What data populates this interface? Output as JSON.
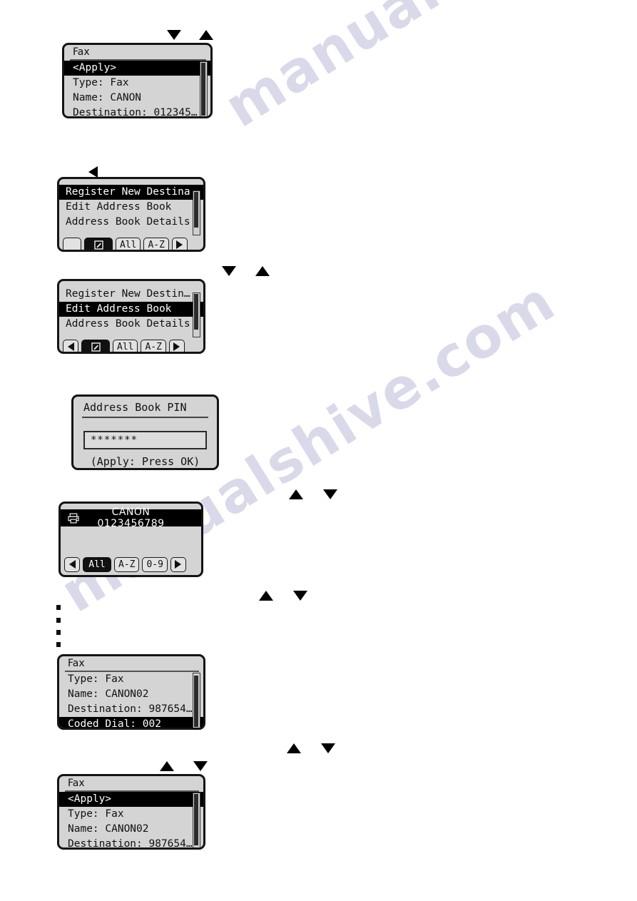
{
  "watermark": {
    "line1": "manualshive.com",
    "line2": "manualshive.com"
  },
  "screens": {
    "fax_apply_canon": {
      "title": "Fax",
      "rows": [
        {
          "text": "<Apply>",
          "selected": true
        },
        {
          "text": "Type: Fax",
          "selected": false
        },
        {
          "text": "Name: CANON",
          "selected": false
        },
        {
          "text": "Destination: 012345…",
          "selected": false
        }
      ]
    },
    "addressbook_menu_1": {
      "rows": [
        {
          "text": "Register New Destina",
          "selected": true
        },
        {
          "text": "Edit Address Book",
          "selected": false
        },
        {
          "text": "Address Book Details",
          "selected": false
        }
      ],
      "toolbar": [
        {
          "label": "",
          "icon": "blank",
          "active": false
        },
        {
          "label": "",
          "icon": "edit-icon",
          "active": true
        },
        {
          "label": "All",
          "icon": "",
          "active": false
        },
        {
          "label": "A-Z",
          "icon": "",
          "active": false
        },
        {
          "label": "",
          "icon": "caret-right-icon",
          "active": false
        }
      ]
    },
    "addressbook_menu_2": {
      "rows": [
        {
          "text": "Register New Destin…",
          "selected": false
        },
        {
          "text": "Edit Address Book",
          "selected": true
        },
        {
          "text": "Address Book Details",
          "selected": false
        }
      ],
      "toolbar": [
        {
          "label": "",
          "icon": "caret-left-icon",
          "active": false
        },
        {
          "label": "",
          "icon": "edit-icon",
          "active": true
        },
        {
          "label": "All",
          "icon": "",
          "active": false
        },
        {
          "label": "A-Z",
          "icon": "",
          "active": false
        },
        {
          "label": "",
          "icon": "caret-right-icon",
          "active": false
        }
      ]
    },
    "address_book_pin": {
      "title": "Address Book PIN",
      "value": "*******",
      "hint": "(Apply: Press OK)"
    },
    "destination_list": {
      "entry": "CANON 0123456789",
      "icon": "fax-machine-icon",
      "toolbar": [
        {
          "label": "",
          "icon": "caret-left-icon",
          "active": false
        },
        {
          "label": "All",
          "icon": "",
          "active": true
        },
        {
          "label": "A-Z",
          "icon": "",
          "active": false
        },
        {
          "label": "0-9",
          "icon": "",
          "active": false
        },
        {
          "label": "",
          "icon": "caret-right-icon",
          "active": false
        }
      ]
    },
    "fax_coded_dial": {
      "title": "Fax",
      "rows": [
        {
          "text": "Type: Fax",
          "selected": false
        },
        {
          "text": "Name: CANON02",
          "selected": false
        },
        {
          "text": "Destination: 987654…",
          "selected": false
        },
        {
          "text": "Coded Dial: 002",
          "selected": true
        }
      ]
    },
    "fax_apply_canon02": {
      "title": "Fax",
      "rows": [
        {
          "text": "<Apply>",
          "selected": true
        },
        {
          "text": "Type: Fax",
          "selected": false
        },
        {
          "text": "Name: CANON02",
          "selected": false
        },
        {
          "text": "Destination: 987654…",
          "selected": false
        }
      ]
    }
  },
  "nav_arrows": [
    {
      "name": "arrow-down-1",
      "direction": "down"
    },
    {
      "name": "arrow-up-1",
      "direction": "up"
    },
    {
      "name": "arrow-left-1",
      "direction": "left"
    },
    {
      "name": "arrow-down-2",
      "direction": "down"
    },
    {
      "name": "arrow-up-2",
      "direction": "up"
    },
    {
      "name": "arrow-up-3",
      "direction": "up"
    },
    {
      "name": "arrow-down-3",
      "direction": "down"
    },
    {
      "name": "arrow-up-4",
      "direction": "up"
    },
    {
      "name": "arrow-down-4",
      "direction": "down"
    },
    {
      "name": "arrow-up-5",
      "direction": "up"
    },
    {
      "name": "arrow-down-5",
      "direction": "down"
    },
    {
      "name": "arrow-up-6",
      "direction": "up"
    },
    {
      "name": "arrow-down-6",
      "direction": "down"
    }
  ],
  "bullets": {
    "count": 4
  },
  "colors": {
    "lcd_bg": "#d4d4d4",
    "lcd_border": "#141414",
    "selection_bg": "#000000",
    "selection_fg": "#ffffff",
    "watermark": "#d9d9ea"
  }
}
